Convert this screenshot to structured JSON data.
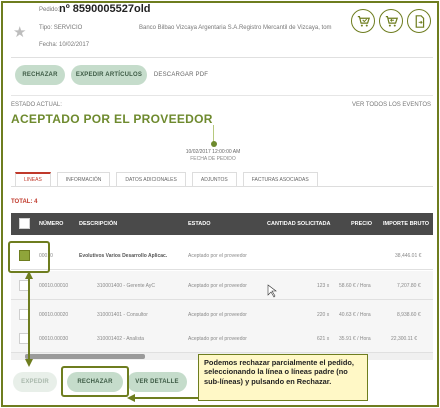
{
  "order": {
    "pedido_label": "Pedido:",
    "pedido_number": "nº 8590005527old",
    "tipo": "Tipo: SERVICIO",
    "bank": "Banco Bilbao Vizcaya Argentaria S.A.Registro Mercantil de Vizcaya, tom",
    "fecha": "Fecha: 10/02/2017"
  },
  "header_icons": [
    "cart-check-icon",
    "cart-back-icon",
    "document-export-icon"
  ],
  "toolbar": {
    "rechazar": "RECHAZAR",
    "expedir_articulos": "EXPEDIR ARTÍCULOS",
    "descargar_pdf": "DESCARGAR PDF"
  },
  "status": {
    "label": "ESTADO ACTUAL:",
    "value": "ACEPTADO POR EL PROVEEDOR",
    "ver_todos": "VER TODOS LOS EVENTOS"
  },
  "timeline": {
    "date": "10/02/2017 12:00:00 AM",
    "label": "FECHA DE PEDIDO"
  },
  "tabs": [
    {
      "label": "LINEAS",
      "active": true
    },
    {
      "label": "INFORMACIÓN",
      "active": false
    },
    {
      "label": "DATOS ADICIONALES",
      "active": false
    },
    {
      "label": "ADJUNTOS",
      "active": false
    },
    {
      "label": "FACTURAS ASOCIADAS",
      "active": false
    }
  ],
  "total_label": "TOTAL: 4",
  "table": {
    "headers": {
      "numero": "NÚMERO",
      "descripcion": "DESCRIPCIÓN",
      "estado": "ESTADO",
      "cantidad": "CANTIDAD SOLICITADA",
      "precio": "PRECIO",
      "importe": "IMPORTE BRUTO"
    },
    "rows": [
      {
        "numero": "00010",
        "descripcion": "Evolutivos Varios Desarrollo Aplicac.",
        "estado": "Aceptado por el proveedor",
        "cantidad": "",
        "precio": "",
        "importe": "38,446.01 €",
        "checked": true,
        "sub": false
      },
      {
        "numero": "00010.00010",
        "descripcion": "310001400 - Gerente AyC",
        "estado": "Aceptado por el proveedor",
        "cantidad": "123 x",
        "precio": "58.60 € / Hora",
        "importe": "7,207.80 €",
        "checked": false,
        "sub": true
      },
      {
        "numero": "00010.00020",
        "descripcion": "310001401 - Consultor",
        "estado": "Aceptado por el proveedor",
        "cantidad": "220 x",
        "precio": "40.63 € / Hora",
        "importe": "8,938.60 €",
        "checked": false,
        "sub": true
      },
      {
        "numero": "00010.00030",
        "descripcion": "310001402 - Analista",
        "estado": "Aceptado por el proveedor",
        "cantidad": "621 x",
        "precio": "35.91 € / Hora",
        "importe": "22,300.11 €",
        "checked": false,
        "sub": true
      }
    ]
  },
  "footer": {
    "expedir": "EXPEDIR",
    "rechazar": "RECHAZAR",
    "ver_detalle": "VER DETALLE"
  },
  "callout_text": "Podemos rechazar parcialmente el pedido, seleccionando la línea o líneas padre (no sub-líneas) y pulsando en Rechazar.",
  "colors": {
    "accent": "#6e7d1f",
    "status_green": "#6e8a2e",
    "button_green": "#c5dccb",
    "active_tab": "#c0392b",
    "callout_bg": "#fff8c6"
  }
}
